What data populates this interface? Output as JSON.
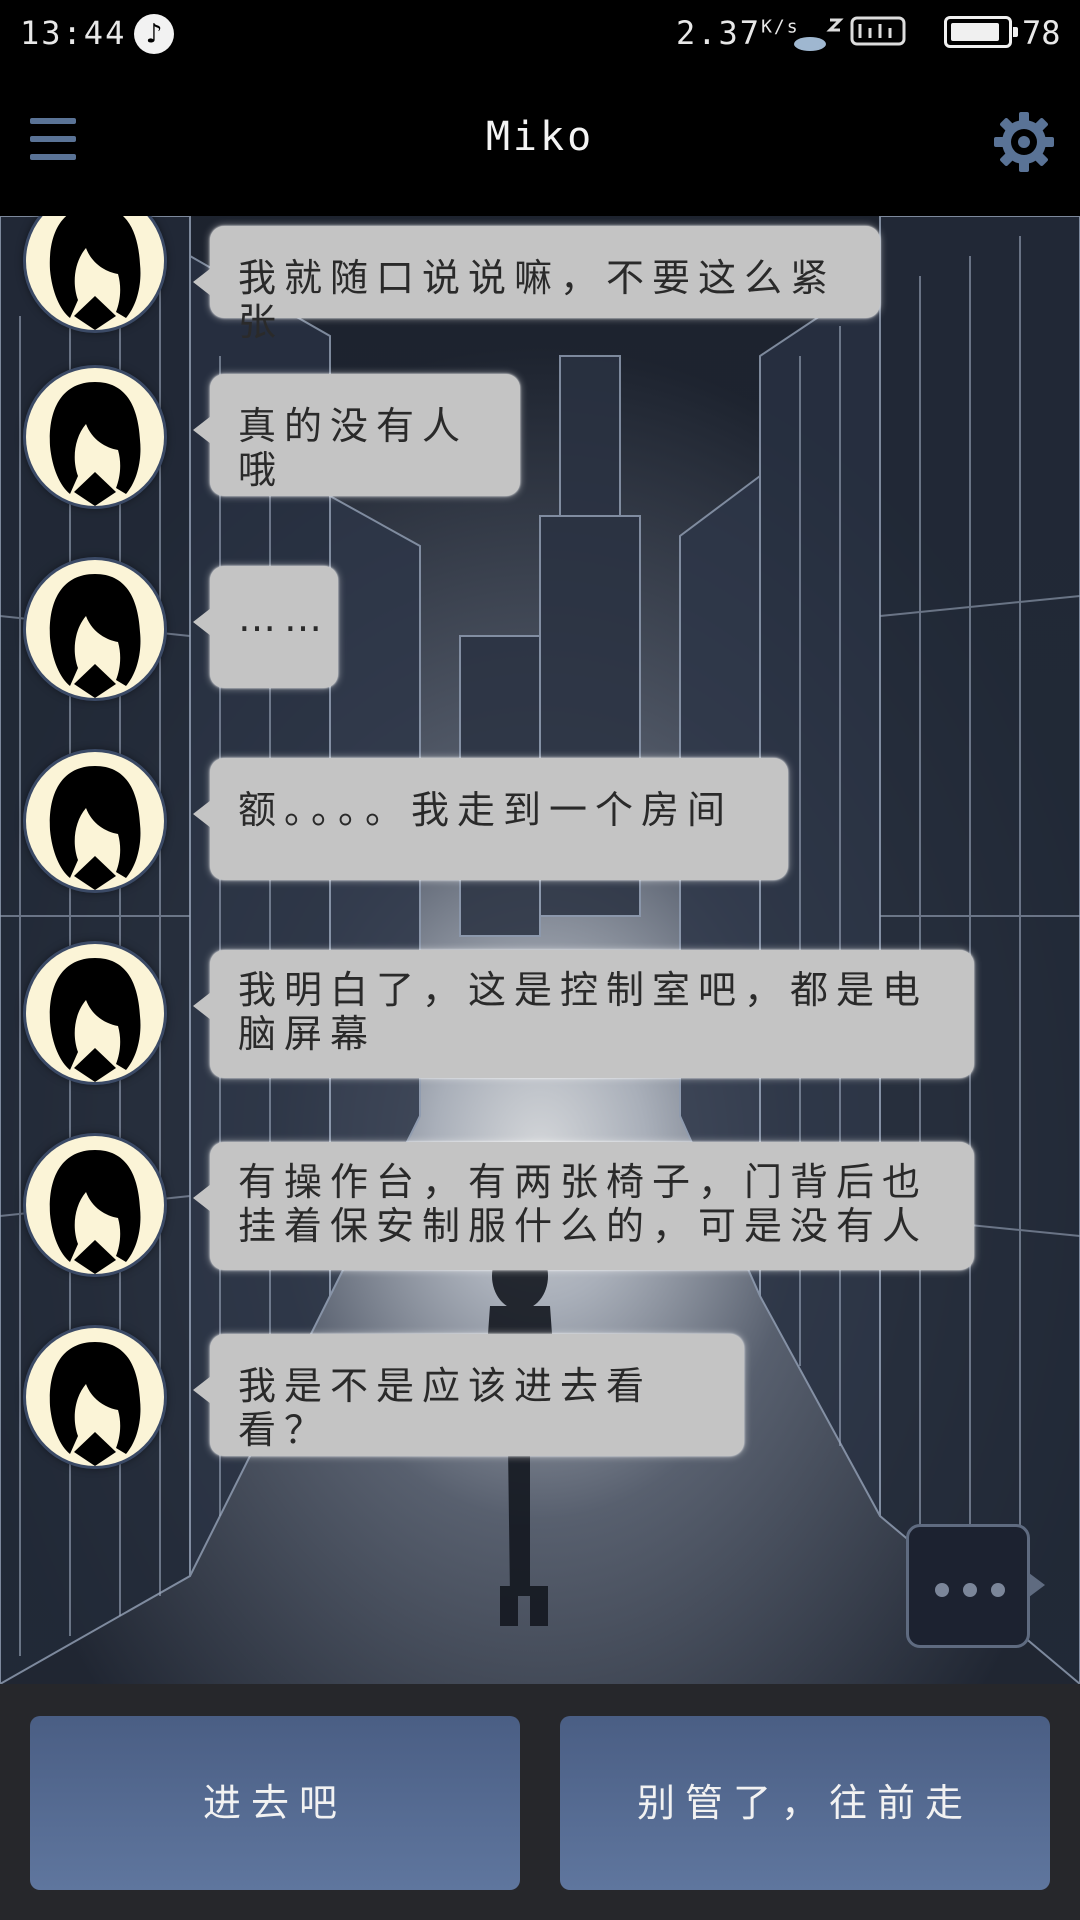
{
  "status_bar": {
    "time": "13:44",
    "net_speed": "2.37",
    "net_speed_unit": "K/s",
    "battery": "78"
  },
  "app_bar": {
    "title": "Miko"
  },
  "messages": [
    {
      "text": "我就随口说说嘛，不要这么紧张"
    },
    {
      "text": "真的没有人哦"
    },
    {
      "text": "……"
    },
    {
      "text": "额。。。。我走到一个房间"
    },
    {
      "text": "我明白了，这是控制室吧，都是电脑屏幕"
    },
    {
      "text": "有操作台，有两张椅子，门背后也挂着保安制服什么的，可是没有人"
    },
    {
      "text": "我是不是应该进去看看？"
    }
  ],
  "choices": {
    "left_label": "进去吧",
    "right_label": "别管了，往前走"
  },
  "colors": {
    "accent": "#5a7396",
    "bubble": "#c4c4c4",
    "button": "#55698f",
    "bottom_bar": "#26272b"
  }
}
